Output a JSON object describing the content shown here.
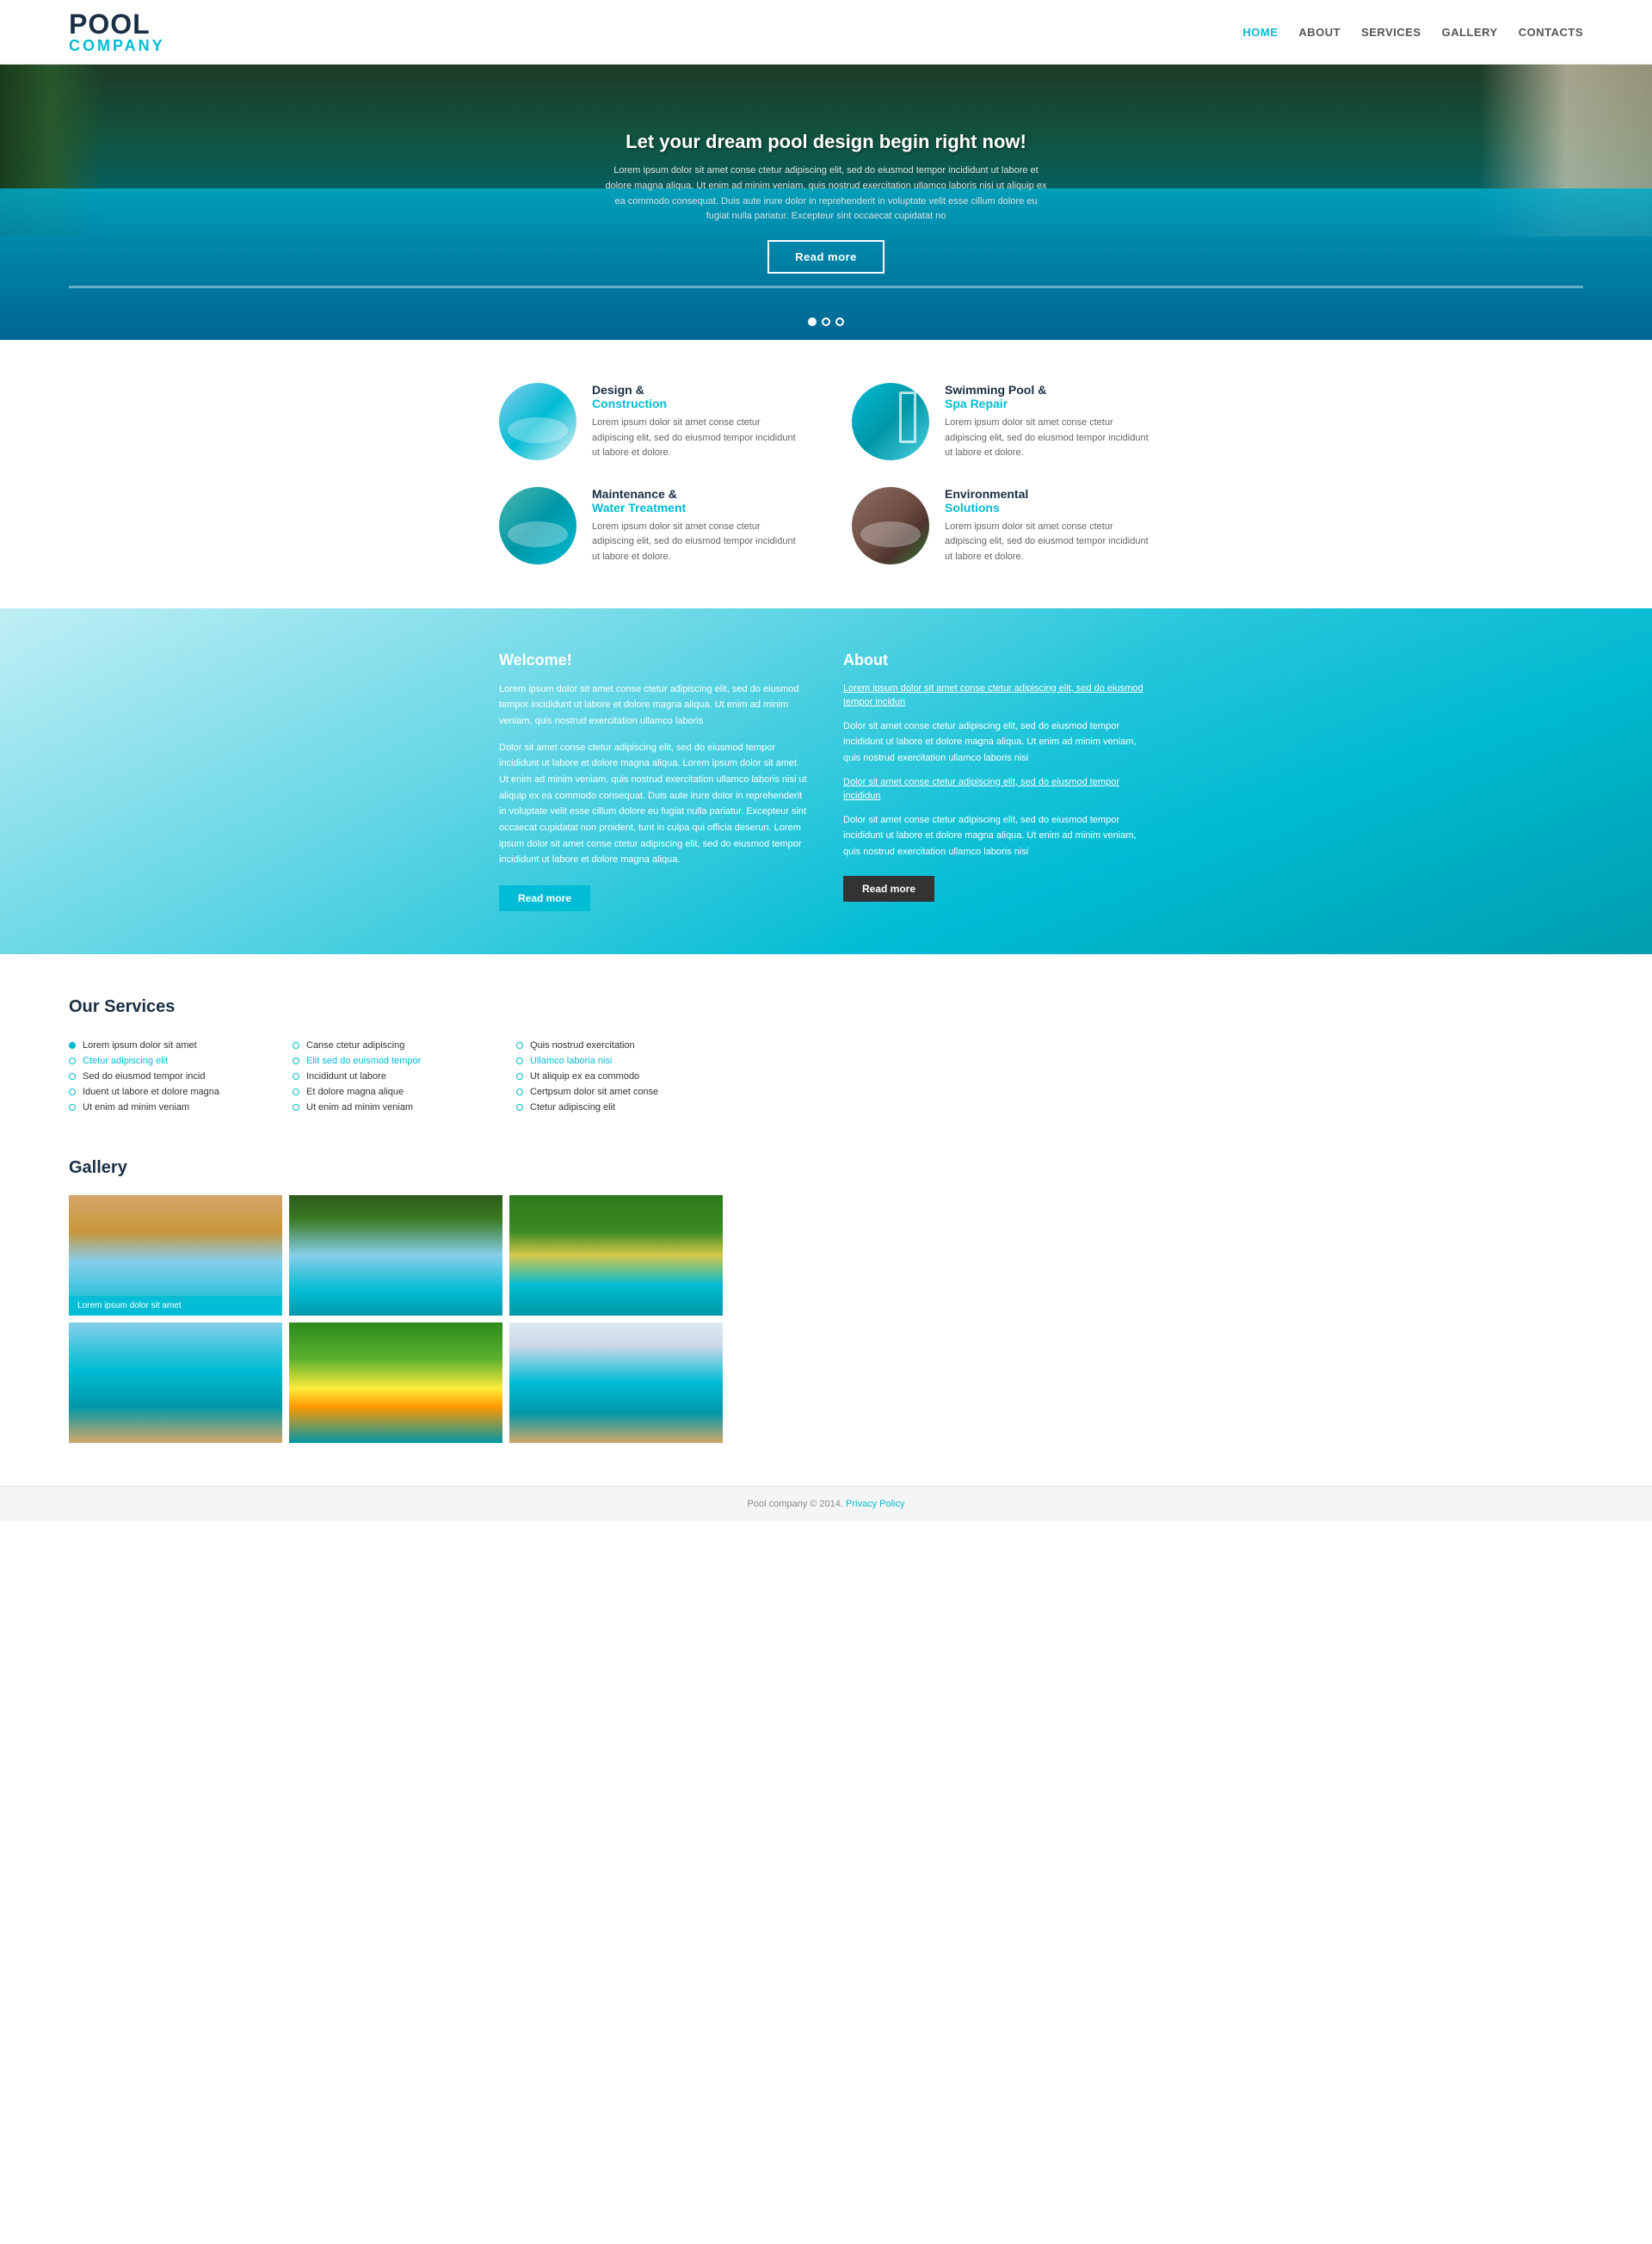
{
  "header": {
    "logo_pool": "POOL",
    "logo_company": "COMPANY",
    "nav": [
      {
        "label": "HOME",
        "active": true
      },
      {
        "label": "ABOUT",
        "active": false
      },
      {
        "label": "SERVICES",
        "active": false
      },
      {
        "label": "GALLERY",
        "active": false
      },
      {
        "label": "CONTACTS",
        "active": false
      }
    ]
  },
  "hero": {
    "title": "Let your dream pool design begin right now!",
    "text": "Lorem ipsum dolor sit amet conse ctetur adipiscing elit, sed do eiusmod tempor incididunt ut labore et dolore magna aliqua. Ut enim ad minim veniam, quis nostrud exercitation ullamco laboris nisi ut aliquip ex ea commodo consequat. Duis aute irure dolor in reprehenderit in voluptate velit esse cillum dolore eu fugiat nulla pariatur. Excepteur sint occaecat cupidatat no",
    "cta_label": "Read more",
    "dots": [
      "dot1",
      "dot2",
      "dot3"
    ]
  },
  "services": {
    "items": [
      {
        "title": "Design &",
        "subtitle": "Construction",
        "text": "Lorem ipsum dolor sit amet conse ctetur adipiscing elit, sed do eiusmod tempor incididunt ut labore et dolore."
      },
      {
        "title": "Swimming Pool &",
        "subtitle": "Spa Repair",
        "text": "Lorem ipsum dolor sit amet conse ctetur adipiscing elit, sed do eiusmod tempor incididunt ut labore et dolore."
      },
      {
        "title": "Maintenance &",
        "subtitle": "Water Treatment",
        "text": "Lorem ipsum dolor sit amet conse ctetur adipiscing elit, sed do eiusmod tempor incididunt ut labore et dolore."
      },
      {
        "title": "Environmental",
        "subtitle": "Solutions",
        "text": "Lorem ipsum dolor sit amet conse ctetur adipiscing elit, sed do eiusmod tempor incididunt ut labore et dolore."
      }
    ]
  },
  "welcome": {
    "title": "Welcome!",
    "para1": "Lorem ipsum dolor sit amet conse ctetur adipiscing elit, sed do eiusmod tempor incididunt ut labore et dolore magna aliqua. Ut enim ad minim veniam, quis nostrud exercitation ullamco laboris",
    "para2": "Dolor sit amet conse ctetur adipiscing elit, sed do eiusmod tempor incididunt ut labore et dolore magna aliqua. Lorem ipsum dolor sit amet. Ut enim ad minim veniam, quis nostrud exercitation ullamco laboris nisi ut aliquip ex ea commodo consequat. Duis aute irure dolor in reprehenderit in voluptate velit esse cillum dolore eu fugiat nulla pariatur. Excepteur sint occaecat cupidatat non proident, tunt in culpa qui officia deserun. Lorem ipsum dolor sit amet conse ctetur adipiscing elit, sed do eiusmod tempor incididunt ut labore et dolore magna aliqua.",
    "btn_label": "Read more"
  },
  "about": {
    "title": "About",
    "link1": "Lorem ipsum dolor sit amet conse ctetur adipiscing elit, sed do eiusmod tempor incidun",
    "para1": "Dolor sit amet conse ctetur adipiscing elit, sed do eiusmod tempor incididunt ut labore et dolore magna aliqua. Ut enim ad minim veniam, quis nostrud exercitation ullamco laboris nisi",
    "link2": "Dolor sit amet conse ctetur adipiscing elit, sed do eiusmod tempor incididun",
    "para2": "Dolor sit amet conse ctetur adipiscing elit, sed do eiusmod tempor incididunt ut labore et dolore magna aliqua. Ut enim ad minim veniam, quis nostrud exercitation ullamco laboris nisi",
    "btn_label": "Read more"
  },
  "our_services": {
    "title": "Our Services",
    "col1": [
      {
        "text": "Lorem ipsum dolor sit amet",
        "filled": true
      },
      {
        "text": "Ctetur adipiscing elit",
        "filled": false,
        "cyan": true
      },
      {
        "text": "Sed do eiusmod tempor incid",
        "filled": false
      },
      {
        "text": "Iduent ut labore et dolore magna",
        "filled": false
      },
      {
        "text": "Ut enim ad minim veniam",
        "filled": false
      }
    ],
    "col2": [
      {
        "text": "Canse ctetur adipiscing",
        "filled": false
      },
      {
        "text": "Elit sed do euismod tempor",
        "filled": false,
        "cyan": true
      },
      {
        "text": "Incididunt ut labore",
        "filled": false
      },
      {
        "text": "Et dolore magna alique",
        "filled": false
      },
      {
        "text": "Ut enim ad minim veniam",
        "filled": false
      }
    ],
    "col3": [
      {
        "text": "Quis nostrud exercitation",
        "filled": false
      },
      {
        "text": "Ullamco laboria nisi",
        "filled": false,
        "cyan": true
      },
      {
        "text": "Ut aliquip ex ea commodo",
        "filled": false
      },
      {
        "text": "Certpsum dolor sit amet conse",
        "filled": false
      },
      {
        "text": "Ctetur adipiscing elit",
        "filled": false
      }
    ]
  },
  "gallery": {
    "title": "Gallery",
    "items": [
      {
        "caption": "Lorem ipsum dolor sit amet",
        "has_caption": true
      },
      {
        "caption": "",
        "has_caption": false
      },
      {
        "caption": "",
        "has_caption": false
      },
      {
        "caption": "",
        "has_caption": false
      },
      {
        "caption": "",
        "has_caption": false
      },
      {
        "caption": "",
        "has_caption": false
      }
    ]
  },
  "footer": {
    "text": "Pool company © 2014.",
    "link_text": "Privacy Policy"
  }
}
